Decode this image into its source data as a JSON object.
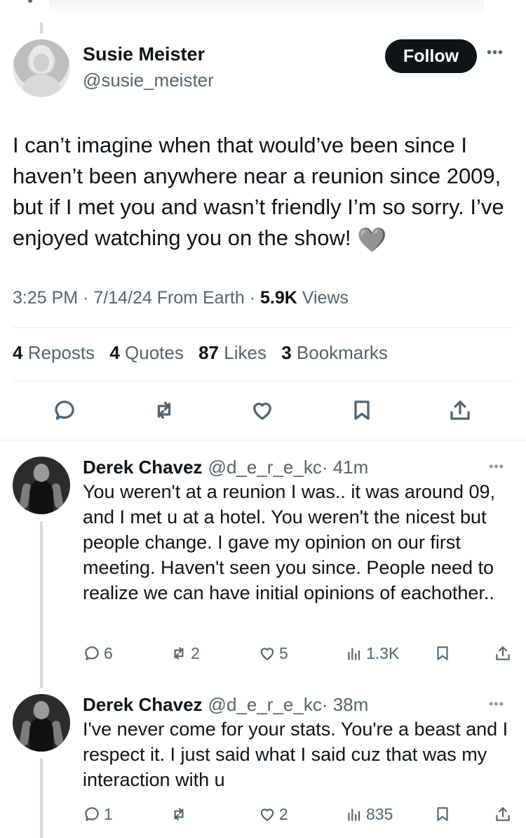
{
  "main_tweet": {
    "author_name": "Susie Meister",
    "author_handle": "@susie_meister",
    "follow_label": "Follow",
    "more_label": "•••",
    "text": "I can’t imagine when that would’ve been since I haven’t been anywhere near a reunion since 2009, but if I met you and wasn’t friendly I’m so sorry. I’ve enjoyed watching you on the show!",
    "emoji": "🩶",
    "time": "3:25 PM",
    "date": "7/14/24",
    "source": "From Earth",
    "views_count": "5.9K",
    "views_label": "Views",
    "stats": [
      {
        "count": "4",
        "label": "Reposts"
      },
      {
        "count": "4",
        "label": "Quotes"
      },
      {
        "count": "87",
        "label": "Likes"
      },
      {
        "count": "3",
        "label": "Bookmarks"
      }
    ],
    "action_icons": [
      "reply-icon",
      "repost-icon",
      "like-icon",
      "bookmark-icon",
      "share-icon"
    ]
  },
  "replies": [
    {
      "author_name": "Derek Chavez",
      "author_handle": "@d_e_r_e_kc",
      "time": "· 41m",
      "more_label": "•••",
      "text": "You weren't at a reunion I was.. it was around 09, and I met u at a hotel. You weren't the nicest but people change. I gave my opinion on our first meeting. Haven't seen you since. People need to realize we can have initial opinions of eachother..",
      "replies": "6",
      "reposts": "2",
      "likes": "5",
      "views": "1.3K"
    },
    {
      "author_name": "Derek Chavez",
      "author_handle": "@d_e_r_e_kc",
      "time": "· 38m",
      "more_label": "•••",
      "text": "I've never come for your stats. You're a beast and I respect it. I just said what I said cuz that was my interaction with u",
      "replies": "1",
      "reposts": "",
      "likes": "2",
      "views": "835"
    }
  ]
}
